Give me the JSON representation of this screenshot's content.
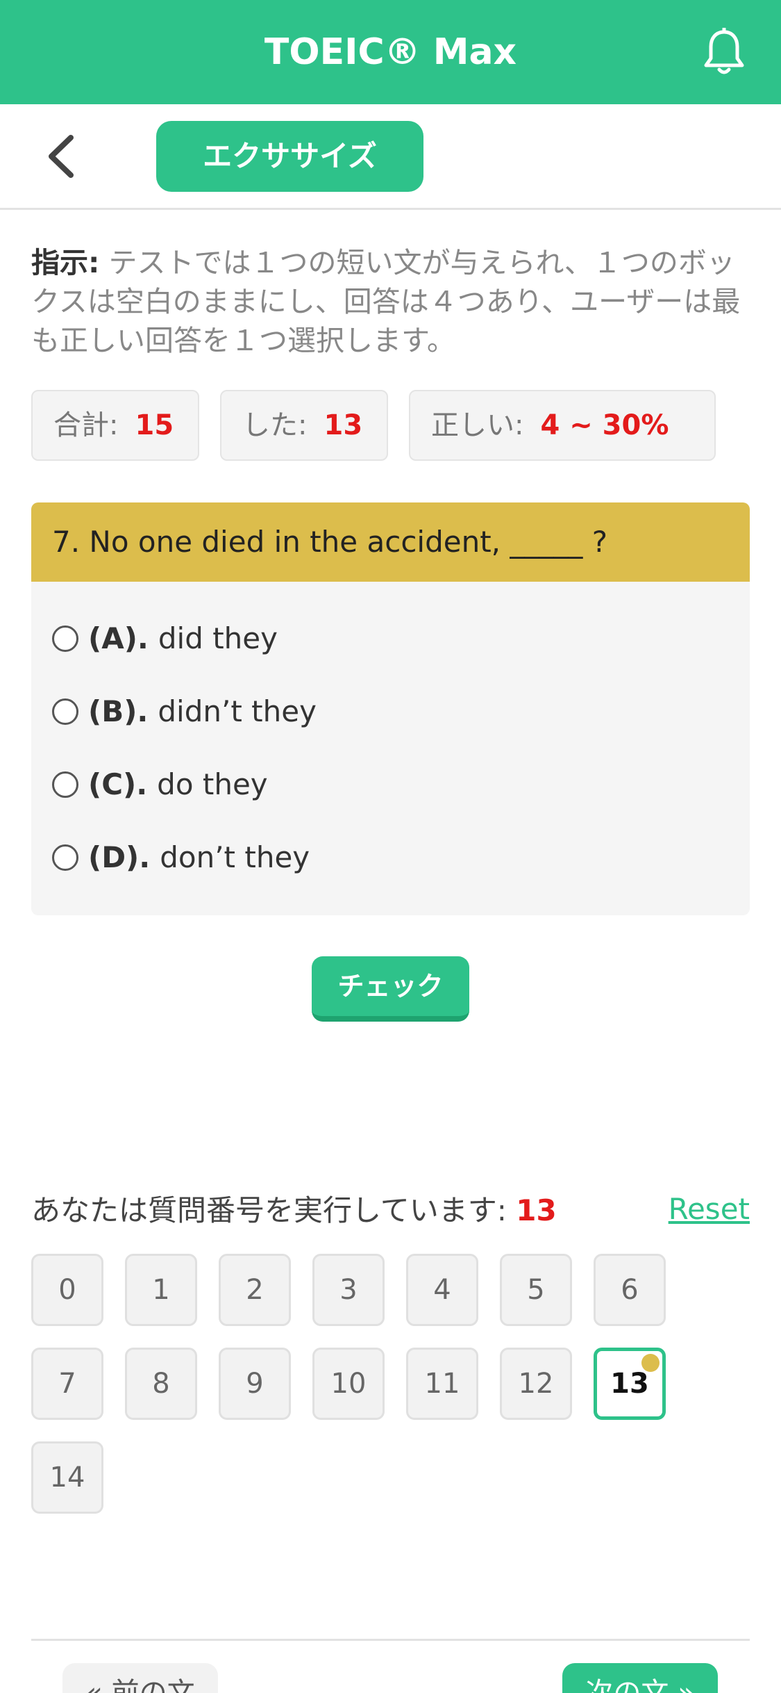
{
  "header": {
    "title": "TOEIC® Max",
    "bell_icon": "bell-icon",
    "brand_color": "#2ec28a"
  },
  "nav": {
    "back_icon": "chevron-left-icon",
    "section_label": "エクササイズ"
  },
  "instructions": {
    "label": "指示:",
    "text": "テストでは１つの短い文が与えられ、１つのボックスは空白のままにし、回答は４つあり、ユーザーは最も正しい回答を１つ選択します。"
  },
  "stats": {
    "total_label": "合計:",
    "total_value": "15",
    "done_label": "した:",
    "done_value": "13",
    "correct_label": "正しい:",
    "correct_value": "4 ~ 30%"
  },
  "question": {
    "text": "7. No one died in the accident, _____ ?",
    "options": [
      {
        "letter": "(A).",
        "text": "did they"
      },
      {
        "letter": "(B).",
        "text": "didn’t they"
      },
      {
        "letter": "(C).",
        "text": "do they"
      },
      {
        "letter": "(D).",
        "text": "don’t they"
      }
    ]
  },
  "check_button": "チェック",
  "progress": {
    "label": "あなたは質問番号を実行しています:",
    "current": "13",
    "reset_label": "Reset",
    "numbers": [
      "0",
      "1",
      "2",
      "3",
      "4",
      "5",
      "6",
      "7",
      "8",
      "9",
      "10",
      "11",
      "12",
      "13",
      "14"
    ]
  },
  "footer": {
    "prev_label": "« 前の文",
    "next_label": "次の文 »"
  }
}
